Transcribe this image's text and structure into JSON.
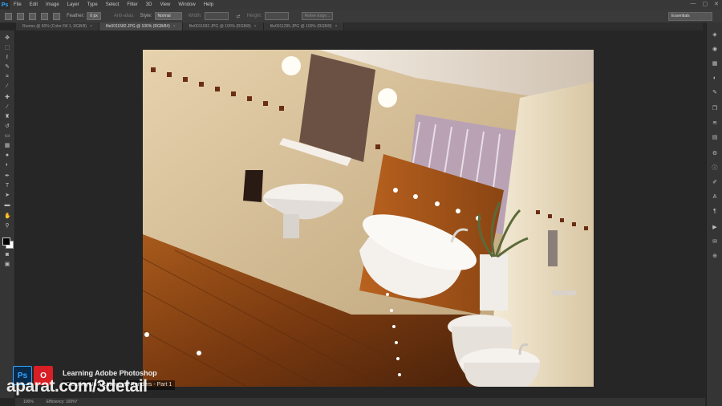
{
  "app": {
    "logo": "Ps"
  },
  "menu": [
    "File",
    "Edit",
    "Image",
    "Layer",
    "Type",
    "Select",
    "Filter",
    "3D",
    "View",
    "Window",
    "Help"
  ],
  "window_controls": [
    "—",
    "▢",
    "✕"
  ],
  "options": {
    "feather_label": "Feather:",
    "feather_value": "0 px",
    "antialias_label": "Anti-alias",
    "style_label": "Style:",
    "style_value": "Normal",
    "width_label": "Width:",
    "height_label": "Height:",
    "refine_label": "Refine Edge...",
    "workspace": "Essentials"
  },
  "tabs": [
    {
      "label": "Rooms @ 50% (Color Fill 1, RGB/8)",
      "active": false
    },
    {
      "label": "file0011582.JPG @ 100% (RGB/8#)",
      "active": true
    },
    {
      "label": "file0011692.JPG @ 100% (RGB/8)",
      "active": false
    },
    {
      "label": "file0011295.JPG @ 100% (RGB/8)",
      "active": false
    }
  ],
  "status": {
    "zoom": "100%",
    "efficiency": "Efficiency: 100%*"
  },
  "overlay": {
    "ps_badge": "Ps",
    "lynda_badge": "O",
    "course_title": "Learning Adobe Photoshop",
    "course_subtitle": "Cleaning Up Architectural Renders - Part 1",
    "watermark": "aparat.com/3detail"
  },
  "colors": {
    "accent": "#31a8ff",
    "lynda_red": "#d81f26"
  },
  "icons": {
    "tools": [
      "move-icon",
      "marquee-icon",
      "lasso-icon",
      "quick-select-icon",
      "crop-icon",
      "eyedropper-icon",
      "healing-icon",
      "brush-icon",
      "stamp-icon",
      "history-brush-icon",
      "eraser-icon",
      "gradient-icon",
      "blur-icon",
      "dodge-icon",
      "pen-icon",
      "type-icon",
      "path-select-icon",
      "shape-icon",
      "hand-icon",
      "zoom-icon"
    ],
    "dock": [
      "history-icon",
      "color-icon",
      "swatches-icon",
      "adjustments-icon",
      "styles-icon",
      "layers-icon",
      "channels-icon",
      "paths-icon",
      "properties-icon",
      "info-icon",
      "brush-preset-icon",
      "character-icon",
      "paragraph-icon",
      "actions-icon",
      "notes-icon",
      "clone-source-icon"
    ]
  }
}
